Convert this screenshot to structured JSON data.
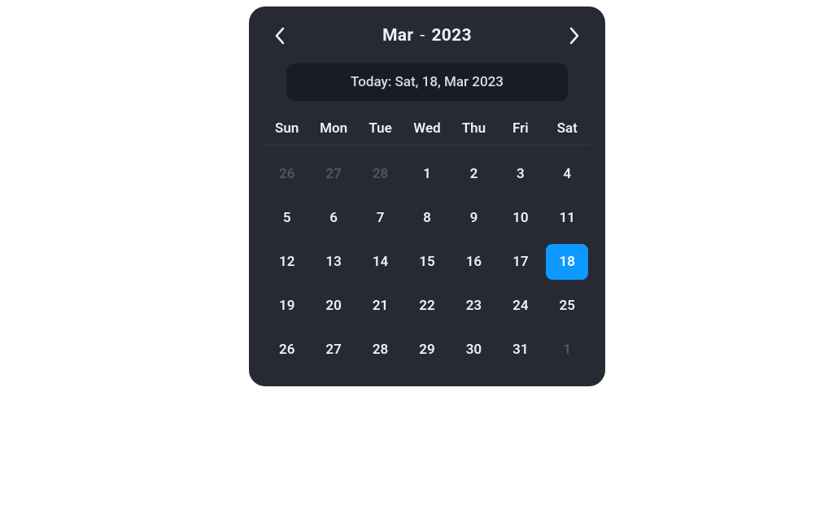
{
  "header": {
    "month": "Mar",
    "separator": "-",
    "year": "2023"
  },
  "today_badge": "Today: Sat, 18, Mar 2023",
  "dow": [
    "Sun",
    "Mon",
    "Tue",
    "Wed",
    "Thu",
    "Fri",
    "Sat"
  ],
  "days": [
    {
      "n": "26",
      "muted": true,
      "highlight": false
    },
    {
      "n": "27",
      "muted": true,
      "highlight": false
    },
    {
      "n": "28",
      "muted": true,
      "highlight": false
    },
    {
      "n": "1",
      "muted": false,
      "highlight": false
    },
    {
      "n": "2",
      "muted": false,
      "highlight": false
    },
    {
      "n": "3",
      "muted": false,
      "highlight": false
    },
    {
      "n": "4",
      "muted": false,
      "highlight": false
    },
    {
      "n": "5",
      "muted": false,
      "highlight": false
    },
    {
      "n": "6",
      "muted": false,
      "highlight": false
    },
    {
      "n": "7",
      "muted": false,
      "highlight": false
    },
    {
      "n": "8",
      "muted": false,
      "highlight": false
    },
    {
      "n": "9",
      "muted": false,
      "highlight": false
    },
    {
      "n": "10",
      "muted": false,
      "highlight": false
    },
    {
      "n": "11",
      "muted": false,
      "highlight": false
    },
    {
      "n": "12",
      "muted": false,
      "highlight": false
    },
    {
      "n": "13",
      "muted": false,
      "highlight": false
    },
    {
      "n": "14",
      "muted": false,
      "highlight": false
    },
    {
      "n": "15",
      "muted": false,
      "highlight": false
    },
    {
      "n": "16",
      "muted": false,
      "highlight": false
    },
    {
      "n": "17",
      "muted": false,
      "highlight": false
    },
    {
      "n": "18",
      "muted": false,
      "highlight": true
    },
    {
      "n": "19",
      "muted": false,
      "highlight": false
    },
    {
      "n": "20",
      "muted": false,
      "highlight": false
    },
    {
      "n": "21",
      "muted": false,
      "highlight": false
    },
    {
      "n": "22",
      "muted": false,
      "highlight": false
    },
    {
      "n": "23",
      "muted": false,
      "highlight": false
    },
    {
      "n": "24",
      "muted": false,
      "highlight": false
    },
    {
      "n": "25",
      "muted": false,
      "highlight": false
    },
    {
      "n": "26",
      "muted": false,
      "highlight": false
    },
    {
      "n": "27",
      "muted": false,
      "highlight": false
    },
    {
      "n": "28",
      "muted": false,
      "highlight": false
    },
    {
      "n": "29",
      "muted": false,
      "highlight": false
    },
    {
      "n": "30",
      "muted": false,
      "highlight": false
    },
    {
      "n": "31",
      "muted": false,
      "highlight": false
    },
    {
      "n": "1",
      "muted": true,
      "highlight": false
    }
  ],
  "colors": {
    "panel": "#272a33",
    "badge": "#1a1c23",
    "text": "#eef1f6",
    "muted": "#52565f",
    "accent": "#0d99ff"
  }
}
